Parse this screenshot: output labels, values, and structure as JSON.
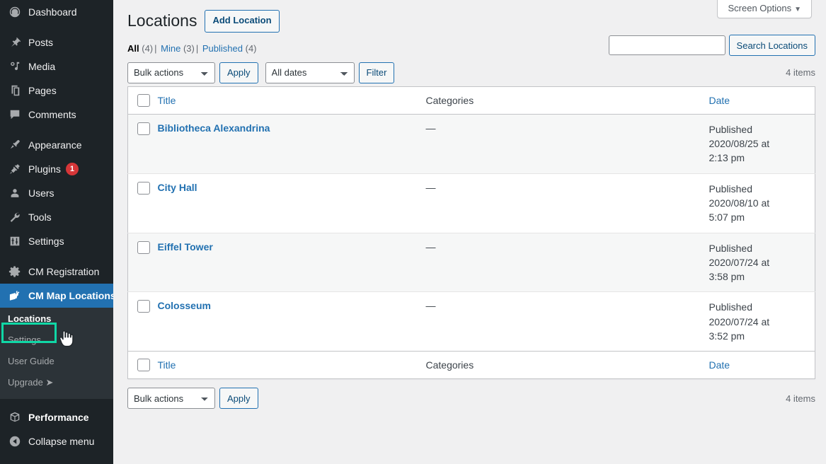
{
  "sidebar": {
    "items": [
      {
        "label": "Dashboard",
        "icon": "dashboard-icon",
        "gap": false
      },
      {
        "label": "Posts",
        "icon": "pin-icon",
        "gap": true
      },
      {
        "label": "Media",
        "icon": "media-icon",
        "gap": false
      },
      {
        "label": "Pages",
        "icon": "pages-icon",
        "gap": false
      },
      {
        "label": "Comments",
        "icon": "comments-icon",
        "gap": false
      },
      {
        "label": "Appearance",
        "icon": "paintbrush-icon",
        "gap": true
      },
      {
        "label": "Plugins",
        "icon": "plug-icon",
        "gap": false,
        "badge": "1"
      },
      {
        "label": "Users",
        "icon": "user-icon",
        "gap": false
      },
      {
        "label": "Tools",
        "icon": "wrench-icon",
        "gap": false
      },
      {
        "label": "Settings",
        "icon": "settings-sliders-icon",
        "gap": false
      },
      {
        "label": "CM Registration",
        "icon": "gear-icon",
        "gap": true
      },
      {
        "label": "CM Map Locations",
        "icon": "map-marker-icon",
        "gap": false,
        "current": true
      }
    ],
    "submenu": [
      {
        "label": "Locations",
        "current": true,
        "highlighted": true
      },
      {
        "label": "Settings",
        "current": false
      },
      {
        "label": "User Guide",
        "current": false
      },
      {
        "label": "Upgrade ➤",
        "current": false
      }
    ],
    "footer_items": [
      {
        "label": "Performance",
        "icon": "box-icon"
      },
      {
        "label": "Collapse menu",
        "icon": "collapse-arrow-icon"
      }
    ],
    "colors": {
      "background": "#1d2327",
      "submenu_background": "#2c3338",
      "current_item": "#2271b1",
      "badge": "#d63638",
      "highlight_box": "#10d7a6"
    }
  },
  "screen_meta": {
    "screen_options_label": "Screen Options",
    "caret": "▼"
  },
  "header": {
    "title": "Locations",
    "add_button": "Add Location"
  },
  "views": {
    "all": {
      "label": "All",
      "count": "(4)"
    },
    "mine": {
      "label": "Mine",
      "count": "(3)"
    },
    "published": {
      "label": "Published",
      "count": "(4)"
    },
    "divider": "|"
  },
  "search": {
    "value": "",
    "placeholder": "",
    "button": "Search Locations"
  },
  "toolbar_top": {
    "bulk_actions_selected": "Bulk actions",
    "apply_label": "Apply",
    "dates_selected": "All dates",
    "filter_label": "Filter",
    "items_count": "4 items"
  },
  "toolbar_bottom": {
    "bulk_actions_selected": "Bulk actions",
    "apply_label": "Apply",
    "items_count": "4 items"
  },
  "table": {
    "columns": {
      "title": "Title",
      "categories": "Categories",
      "date": "Date"
    },
    "rows": [
      {
        "title": "Bibliotheca Alexandrina",
        "categories": "—",
        "status": "Published",
        "date": "2020/08/25 at",
        "time": "2:13 pm"
      },
      {
        "title": "City Hall",
        "categories": "—",
        "status": "Published",
        "date": "2020/08/10 at",
        "time": "5:07 pm"
      },
      {
        "title": "Eiffel Tower",
        "categories": "—",
        "status": "Published",
        "date": "2020/07/24 at",
        "time": "3:58 pm"
      },
      {
        "title": "Colosseum",
        "categories": "—",
        "status": "Published",
        "date": "2020/07/24 at",
        "time": "3:52 pm"
      }
    ]
  }
}
